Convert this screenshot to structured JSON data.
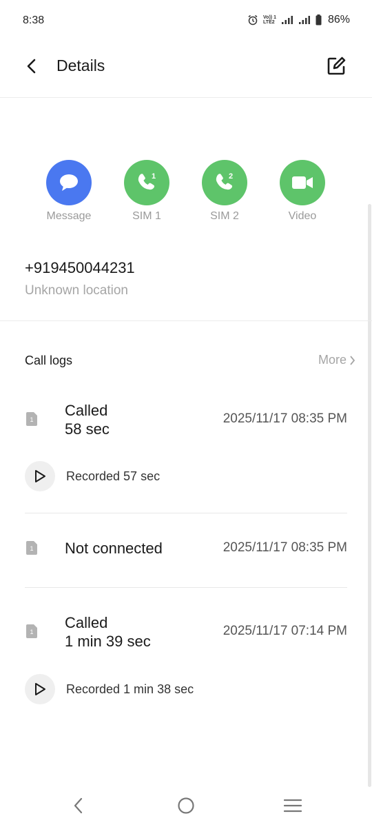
{
  "status_bar": {
    "time": "8:38",
    "lte_top": "Vo)) 1",
    "lte_bottom": "LTE2",
    "battery": "86%"
  },
  "app_bar": {
    "title": "Details",
    "back_icon": "chevron-left-icon",
    "edit_icon": "edit-icon"
  },
  "actions": [
    {
      "label": "Message",
      "icon": "message-icon",
      "color": "#4a78f0"
    },
    {
      "label": "SIM 1",
      "icon": "phone-sim1-icon",
      "sim": "1",
      "color": "#5ec46a"
    },
    {
      "label": "SIM 2",
      "icon": "phone-sim2-icon",
      "sim": "2",
      "color": "#5ec46a"
    },
    {
      "label": "Video",
      "icon": "video-icon",
      "color": "#5ec46a"
    }
  ],
  "contact": {
    "number": "+919450044231",
    "location": "Unknown location"
  },
  "call_logs": {
    "title": "Call logs",
    "more": "More",
    "entries": [
      {
        "status_line1": "Called",
        "status_line2": "58 sec",
        "datetime": "2025/11/17 08:35 PM",
        "sim": "1",
        "recording": "Recorded 57 sec"
      },
      {
        "status_line1": "Not connected",
        "status_line2": "",
        "datetime": "2025/11/17 08:35 PM",
        "sim": "1",
        "recording": ""
      },
      {
        "status_line1": "Called",
        "status_line2": "1 min 39 sec",
        "datetime": "2025/11/17 07:14 PM",
        "sim": "1",
        "recording": "Recorded 1 min 38 sec"
      }
    ]
  },
  "nav_bar": {
    "back_icon": "nav-back-icon",
    "home_icon": "nav-home-icon",
    "menu_icon": "nav-menu-icon"
  }
}
